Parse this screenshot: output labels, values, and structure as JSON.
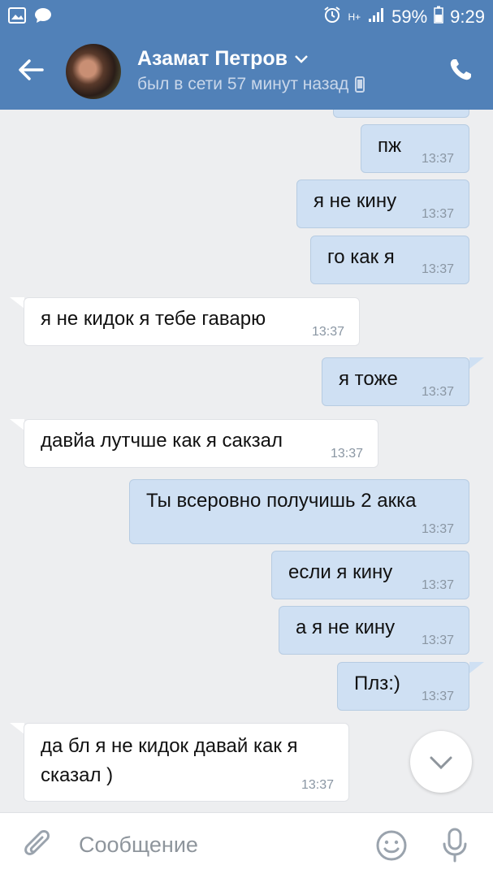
{
  "status_bar": {
    "battery": "59%",
    "time": "9:29",
    "network": "H+"
  },
  "header": {
    "name": "Азамат Петров",
    "status": "был в сети 57 минут назад"
  },
  "messages": [
    {
      "id": "m1",
      "dir": "out",
      "text": "пж",
      "time": "13:37"
    },
    {
      "id": "m2",
      "dir": "out",
      "text": "я не кину",
      "time": "13:37"
    },
    {
      "id": "m3",
      "dir": "out",
      "text": "го как я",
      "time": "13:37"
    },
    {
      "id": "m4",
      "dir": "in",
      "text": "я не кидок я тебе гаварю",
      "time": "13:37"
    },
    {
      "id": "m5",
      "dir": "out",
      "text": "я тоже",
      "time": "13:37"
    },
    {
      "id": "m6",
      "dir": "in",
      "text": "давйа лутчше как я сакзал",
      "time": "13:37"
    },
    {
      "id": "m7",
      "dir": "out",
      "text": "Ты всеровно получишь 2 акка",
      "time": "13:37"
    },
    {
      "id": "m8",
      "dir": "out",
      "text": "если я кину",
      "time": "13:37"
    },
    {
      "id": "m9",
      "dir": "out",
      "text": "а я не кину",
      "time": "13:37"
    },
    {
      "id": "m10",
      "dir": "out",
      "text": "Плз:)",
      "time": "13:37"
    },
    {
      "id": "m11",
      "dir": "in",
      "text_line1": "да бл я не кидок давай как я",
      "text_line2": "сказал )",
      "time": "13:37"
    }
  ],
  "composer": {
    "placeholder": "Сообщение"
  },
  "colors": {
    "header_bg": "#5181b8",
    "outgoing_bubble": "#cfe0f3",
    "incoming_bubble": "#ffffff",
    "feed_bg": "#edeef0"
  }
}
